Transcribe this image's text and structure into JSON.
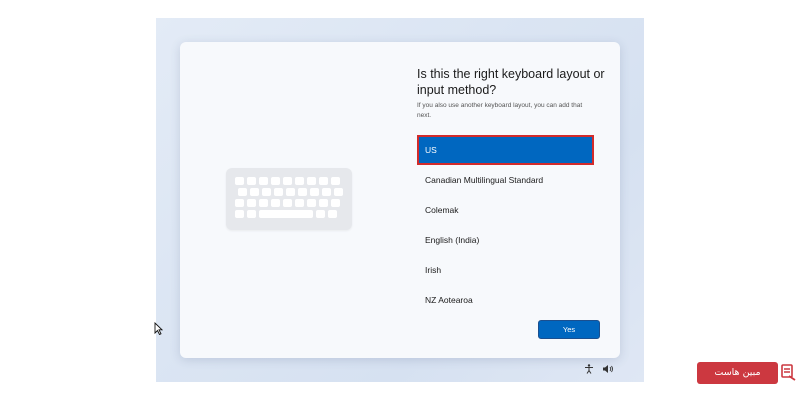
{
  "dialog": {
    "heading": "Is this the right keyboard layout or input method?",
    "subtext": "If you also use another keyboard layout, you can add that next."
  },
  "layouts": [
    {
      "label": "US",
      "selected": true
    },
    {
      "label": "Canadian Multilingual Standard",
      "selected": false
    },
    {
      "label": "Colemak",
      "selected": false
    },
    {
      "label": "English (India)",
      "selected": false
    },
    {
      "label": "Irish",
      "selected": false
    },
    {
      "label": "NZ Aotearoa",
      "selected": false
    }
  ],
  "actions": {
    "yes_label": "Yes"
  },
  "tray": {
    "accessibility_icon": "accessibility-icon",
    "volume_icon": "volume-icon"
  },
  "watermark": {
    "text": "مبین هاست",
    "icon": "host-logo-icon"
  },
  "colors": {
    "accent": "#0067c0",
    "selection_outline": "#d22b2b",
    "brand": "#cc3840"
  }
}
